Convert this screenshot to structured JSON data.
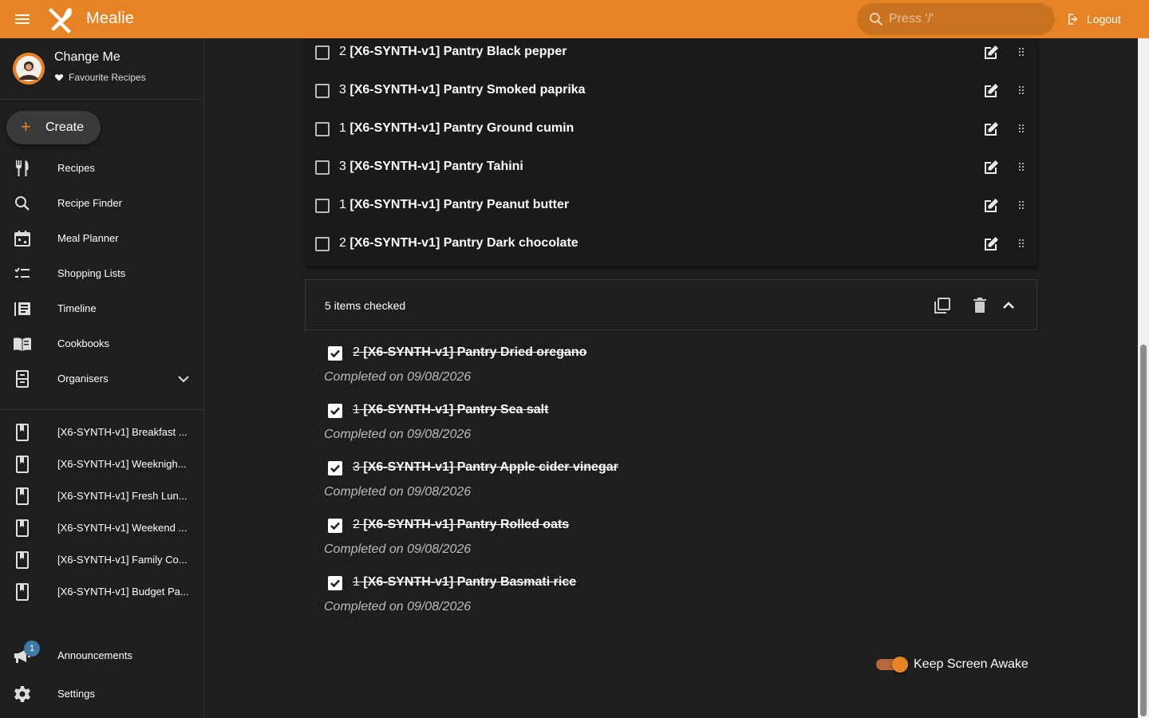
{
  "app": {
    "title": "Mealie"
  },
  "search": {
    "placeholder": "Press '/'"
  },
  "header": {
    "logout_label": "Logout"
  },
  "user": {
    "name": "Change Me",
    "favourites_label": "Favourite Recipes"
  },
  "sidebar": {
    "create_label": "Create",
    "nav": [
      {
        "label": "Recipes",
        "icon": "fork-knife-icon"
      },
      {
        "label": "Recipe Finder",
        "icon": "search-icon"
      },
      {
        "label": "Meal Planner",
        "icon": "calendar-icon"
      },
      {
        "label": "Shopping Lists",
        "icon": "checklist-icon"
      },
      {
        "label": "Timeline",
        "icon": "timeline-icon"
      },
      {
        "label": "Cookbooks",
        "icon": "book-open-icon"
      },
      {
        "label": "Organisers",
        "icon": "file-cabinet-icon"
      }
    ],
    "cookbooks": [
      {
        "label": "[X6-SYNTH-v1] Breakfast ..."
      },
      {
        "label": "[X6-SYNTH-v1] Weeknigh..."
      },
      {
        "label": "[X6-SYNTH-v1] Fresh Lun..."
      },
      {
        "label": "[X6-SYNTH-v1] Weekend ..."
      },
      {
        "label": "[X6-SYNTH-v1] Family Co..."
      },
      {
        "label": "[X6-SYNTH-v1] Budget Pa..."
      }
    ],
    "announcements_label": "Announcements",
    "announcements_badge": "1",
    "settings_label": "Settings"
  },
  "shopping_list": {
    "unchecked_items": [
      {
        "qty": "2",
        "name": "[X6-SYNTH-v1] Pantry Black pepper"
      },
      {
        "qty": "3",
        "name": "[X6-SYNTH-v1] Pantry Smoked paprika"
      },
      {
        "qty": "1",
        "name": "[X6-SYNTH-v1] Pantry Ground cumin"
      },
      {
        "qty": "3",
        "name": "[X6-SYNTH-v1] Pantry Tahini"
      },
      {
        "qty": "1",
        "name": "[X6-SYNTH-v1] Pantry Peanut butter"
      },
      {
        "qty": "2",
        "name": "[X6-SYNTH-v1] Pantry Dark chocolate"
      }
    ],
    "checked_summary": "5 items checked",
    "checked_items": [
      {
        "qty": "2",
        "name": "[X6-SYNTH-v1] Pantry Dried oregano",
        "completed": "Completed on 09/08/2026"
      },
      {
        "qty": "1",
        "name": "[X6-SYNTH-v1] Pantry Sea salt",
        "completed": "Completed on 09/08/2026"
      },
      {
        "qty": "3",
        "name": "[X6-SYNTH-v1] Pantry Apple cider vinegar",
        "completed": "Completed on 09/08/2026"
      },
      {
        "qty": "2",
        "name": "[X6-SYNTH-v1] Pantry Rolled oats",
        "completed": "Completed on 09/08/2026"
      },
      {
        "qty": "1",
        "name": "[X6-SYNTH-v1] Pantry Basmati rice",
        "completed": "Completed on 09/08/2026"
      }
    ],
    "keep_awake_label": "Keep Screen Awake",
    "keep_awake_on": true
  },
  "colors": {
    "accent": "#e58325",
    "background": "#1e1e1e",
    "badge": "#3d7aa6"
  }
}
